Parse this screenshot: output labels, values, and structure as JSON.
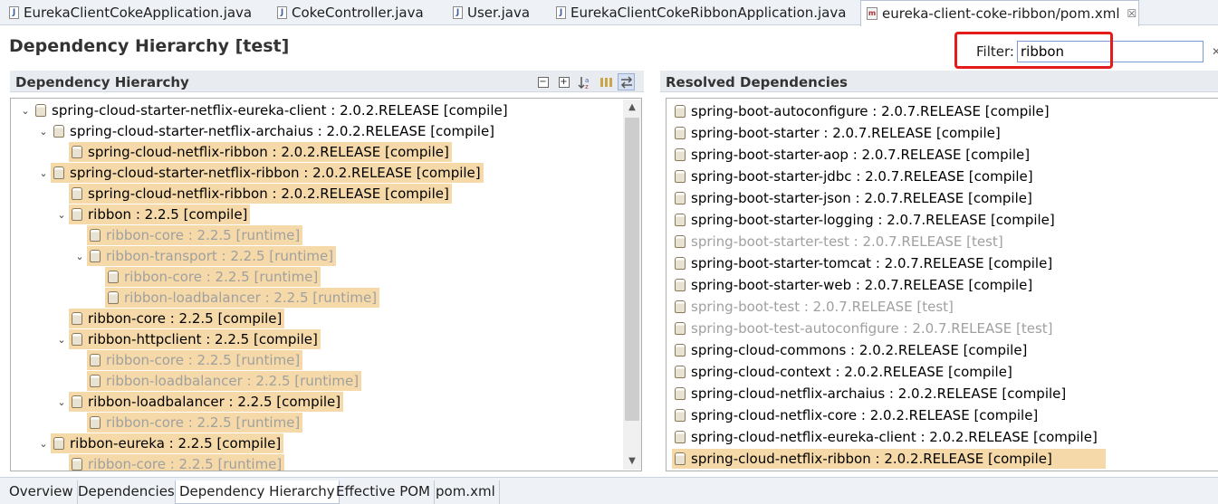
{
  "editor_tabs": [
    {
      "label": "EurekaClientCokeApplication.java",
      "icon": "java-file-icon"
    },
    {
      "label": "CokeController.java",
      "icon": "java-file-icon"
    },
    {
      "label": "User.java",
      "icon": "java-file-icon"
    },
    {
      "label": "EurekaClientCokeRibbonApplication.java",
      "icon": "java-file-icon"
    },
    {
      "label": "eureka-client-coke-ribbon/pom.xml",
      "icon": "maven-pom-icon",
      "active": true,
      "close": "☒"
    }
  ],
  "header": {
    "title": "Dependency Hierarchy [test]",
    "filter_label": "Filter:",
    "filter_value": "ribbon",
    "clear_glyph": "✕"
  },
  "left_panel": {
    "title": "Dependency Hierarchy",
    "tree": [
      {
        "level": 0,
        "expanded": true,
        "label": "spring-cloud-starter-netflix-eureka-client : 2.0.2.RELEASE [compile]",
        "highlighted": false,
        "muted": false
      },
      {
        "level": 1,
        "expanded": true,
        "label": "spring-cloud-starter-netflix-archaius : 2.0.2.RELEASE [compile]",
        "highlighted": false,
        "muted": false
      },
      {
        "level": 2,
        "expanded": null,
        "label": "spring-cloud-netflix-ribbon : 2.0.2.RELEASE [compile]",
        "highlighted": true,
        "muted": false
      },
      {
        "level": 1,
        "expanded": true,
        "label": "spring-cloud-starter-netflix-ribbon : 2.0.2.RELEASE [compile]",
        "highlighted": true,
        "muted": false
      },
      {
        "level": 2,
        "expanded": null,
        "label": "spring-cloud-netflix-ribbon : 2.0.2.RELEASE [compile]",
        "highlighted": true,
        "muted": false
      },
      {
        "level": 2,
        "expanded": true,
        "label": "ribbon : 2.2.5 [compile]",
        "highlighted": true,
        "muted": false
      },
      {
        "level": 3,
        "expanded": null,
        "label": "ribbon-core : 2.2.5 [runtime]",
        "highlighted": true,
        "muted": true
      },
      {
        "level": 3,
        "expanded": true,
        "label": "ribbon-transport : 2.2.5 [runtime]",
        "highlighted": true,
        "muted": true
      },
      {
        "level": 4,
        "expanded": null,
        "label": "ribbon-core : 2.2.5 [runtime]",
        "highlighted": true,
        "muted": true
      },
      {
        "level": 4,
        "expanded": null,
        "label": "ribbon-loadbalancer : 2.2.5 [runtime]",
        "highlighted": true,
        "muted": true
      },
      {
        "level": 2,
        "expanded": null,
        "label": "ribbon-core : 2.2.5 [compile]",
        "highlighted": true,
        "muted": false
      },
      {
        "level": 2,
        "expanded": true,
        "label": "ribbon-httpclient : 2.2.5 [compile]",
        "highlighted": true,
        "muted": false
      },
      {
        "level": 3,
        "expanded": null,
        "label": "ribbon-core : 2.2.5 [runtime]",
        "highlighted": true,
        "muted": true
      },
      {
        "level": 3,
        "expanded": null,
        "label": "ribbon-loadbalancer : 2.2.5 [runtime]",
        "highlighted": true,
        "muted": true
      },
      {
        "level": 2,
        "expanded": true,
        "label": "ribbon-loadbalancer : 2.2.5 [compile]",
        "highlighted": true,
        "muted": false
      },
      {
        "level": 3,
        "expanded": null,
        "label": "ribbon-core : 2.2.5 [runtime]",
        "highlighted": true,
        "muted": true
      },
      {
        "level": 1,
        "expanded": true,
        "label": "ribbon-eureka : 2.2.5 [compile]",
        "highlighted": true,
        "muted": false
      },
      {
        "level": 2,
        "expanded": null,
        "label": "ribbon-core : 2.2.5 [runtime]",
        "highlighted": true,
        "muted": true
      }
    ],
    "scroll": {
      "up": "▲",
      "down": "▼"
    },
    "twisty": {
      "open": "⌄",
      "closed": "›"
    }
  },
  "right_panel": {
    "title": "Resolved Dependencies",
    "items": [
      {
        "label": "spring-boot-autoconfigure : 2.0.7.RELEASE [compile]",
        "muted": false,
        "highlighted": false
      },
      {
        "label": "spring-boot-starter : 2.0.7.RELEASE [compile]",
        "muted": false,
        "highlighted": false
      },
      {
        "label": "spring-boot-starter-aop : 2.0.7.RELEASE [compile]",
        "muted": false,
        "highlighted": false
      },
      {
        "label": "spring-boot-starter-jdbc : 2.0.7.RELEASE [compile]",
        "muted": false,
        "highlighted": false
      },
      {
        "label": "spring-boot-starter-json : 2.0.7.RELEASE [compile]",
        "muted": false,
        "highlighted": false
      },
      {
        "label": "spring-boot-starter-logging : 2.0.7.RELEASE [compile]",
        "muted": false,
        "highlighted": false
      },
      {
        "label": "spring-boot-starter-test : 2.0.7.RELEASE [test]",
        "muted": true,
        "highlighted": false
      },
      {
        "label": "spring-boot-starter-tomcat : 2.0.7.RELEASE [compile]",
        "muted": false,
        "highlighted": false
      },
      {
        "label": "spring-boot-starter-web : 2.0.7.RELEASE [compile]",
        "muted": false,
        "highlighted": false
      },
      {
        "label": "spring-boot-test : 2.0.7.RELEASE [test]",
        "muted": true,
        "highlighted": false
      },
      {
        "label": "spring-boot-test-autoconfigure : 2.0.7.RELEASE [test]",
        "muted": true,
        "highlighted": false
      },
      {
        "label": "spring-cloud-commons : 2.0.2.RELEASE [compile]",
        "muted": false,
        "highlighted": false
      },
      {
        "label": "spring-cloud-context : 2.0.2.RELEASE [compile]",
        "muted": false,
        "highlighted": false
      },
      {
        "label": "spring-cloud-netflix-archaius : 2.0.2.RELEASE [compile]",
        "muted": false,
        "highlighted": false
      },
      {
        "label": "spring-cloud-netflix-core : 2.0.2.RELEASE [compile]",
        "muted": false,
        "highlighted": false
      },
      {
        "label": "spring-cloud-netflix-eureka-client : 2.0.2.RELEASE [compile]",
        "muted": false,
        "highlighted": false
      },
      {
        "label": "spring-cloud-netflix-ribbon : 2.0.2.RELEASE [compile]",
        "muted": false,
        "highlighted": true
      }
    ]
  },
  "bottom_tabs": [
    {
      "label": "Overview"
    },
    {
      "label": "Dependencies"
    },
    {
      "label": "Dependency Hierarchy",
      "active": true
    },
    {
      "label": "Effective POM"
    },
    {
      "label": "pom.xml"
    }
  ],
  "colors": {
    "highlight": "#f5d9a8",
    "muted_text": "#a0a0a0",
    "annotation_box": "#e41b1b"
  }
}
